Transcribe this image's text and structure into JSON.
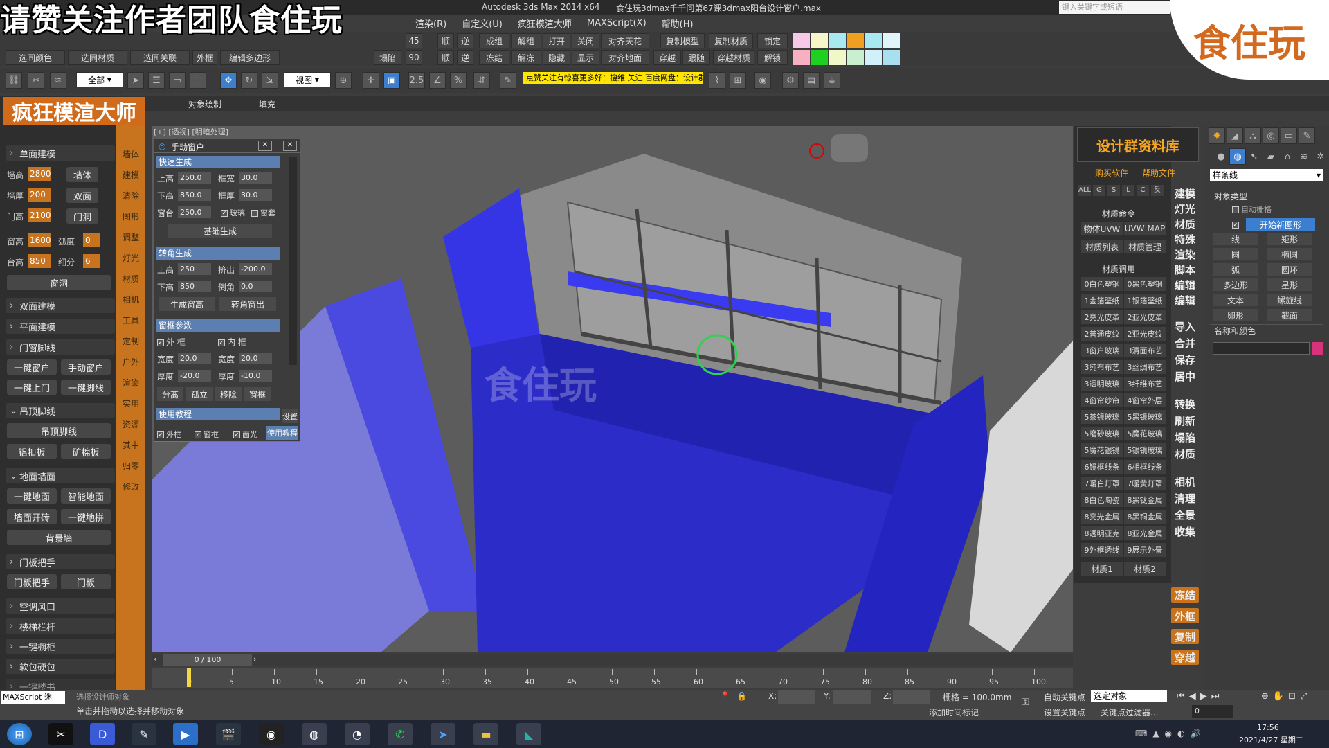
{
  "overlay_title": "请赞关注作者团队食住玩",
  "window": {
    "app_title": "Autodesk 3ds Max  2014 x64",
    "file_title": "食住玩3dmax千千问第67课3dmax阳台设计窗户.max",
    "search_placeholder": "键入关键字或短语"
  },
  "corner_logo": "食住玩",
  "menu": [
    "渲染(R)",
    "自定义(U)",
    "疯狂模渲大师",
    "MAXScript(X)",
    "帮助(H)"
  ],
  "toolbar_row1": [
    "成组",
    "解组",
    "打开",
    "关闭",
    "对齐天花",
    "复制模型",
    "复制材质",
    "锁定"
  ],
  "toolbar_row2": [
    "选同颜色",
    "选同材质",
    "选同关联",
    "外框",
    "编辑多边形",
    "塌陷",
    "冻结",
    "解冻",
    "隐藏",
    "显示",
    "对齐地面",
    "穿越",
    "跟随",
    "穿越材质",
    "解锁"
  ],
  "toolbar_small": [
    "45",
    "90",
    "顺",
    "逆",
    "顺",
    "逆"
  ],
  "swatch_colors": [
    "#f6c9e6",
    "#f6f6c8",
    "#a8e8f0",
    "#f0a020",
    "#a8e8f0",
    "#e0f4fa",
    "#f6b0c0",
    "#20d020",
    "#f0f8c8",
    "#c8f0d0",
    "#d0f0fa",
    "#a8e0f0"
  ],
  "toolbar2": {
    "select_filter": "全部",
    "view_dropdown": "视图",
    "yellow_note": "点赞关注有惊喜更多好：搜维·关注 百度网盘：设计群资料库"
  },
  "ribbon": [
    "对象绘制",
    "填充"
  ],
  "brand": "疯狂模渲大师",
  "sidebar": {
    "sections": [
      "单面建模",
      "双面建模",
      "平面建模",
      "门窗脚线",
      "吊顶脚线",
      "地面墙面",
      "门板把手",
      "空调风口",
      "楼梯栏杆",
      "一键橱柜",
      "软包硬包",
      "一键楼书"
    ],
    "fields": [
      {
        "label": "墙高",
        "value": "2800",
        "button": "墙体"
      },
      {
        "label": "墙厚",
        "value": "200",
        "button": "双面"
      },
      {
        "label": "门高",
        "value": "2100",
        "button": "门洞"
      }
    ],
    "window_fields": [
      {
        "label": "窗高",
        "value": "1600",
        "label2": "弧度",
        "value2": "0"
      },
      {
        "label": "台高",
        "value": "850",
        "label2": "细分",
        "value2": "6"
      }
    ],
    "buttons": {
      "window_hole": "窗洞",
      "one_key_window": "一键窗户",
      "manual_window": "手动窗户",
      "one_key_door": "一键上门",
      "one_key_baseboard": "一键脚线",
      "ceiling_baseboard": "吊顶脚线",
      "aluminum": "铝扣板",
      "mineral": "矿棉板",
      "one_key_floor": "一键地面",
      "smart_floor": "智能地面",
      "wall_tile": "墙面开砖",
      "one_key_tile": "一键地拼",
      "background_wall": "背景墙",
      "door_handle": "门板把手",
      "door_panel": "门板"
    },
    "orange_col": [
      "墙体",
      "建模",
      "清除",
      "图形",
      "调整",
      "灯光",
      "材质",
      "相机",
      "工具",
      "定制",
      "户外",
      "渲染",
      "实用",
      "资源",
      "其中",
      "归零",
      "修改"
    ]
  },
  "viewport": {
    "label": "[+] [透视] [明暗处理]",
    "watermark": "食住玩"
  },
  "dialog": {
    "title": "手动窗户",
    "sec1": "快速生成",
    "row1": {
      "l1": "上高",
      "v1": "250.0",
      "l2": "框宽",
      "v2": "30.0"
    },
    "row2": {
      "l1": "下高",
      "v1": "850.0",
      "l2": "框厚",
      "v2": "30.0"
    },
    "row3": {
      "l1": "窗台",
      "v1": "250.0",
      "c1": "玻璃",
      "c2": "窗套"
    },
    "basic_gen": "基础生成",
    "sec2": "转角生成",
    "row4": {
      "l1": "上高",
      "v1": "250",
      "l2": "挤出",
      "v2": "-200.0"
    },
    "row5": {
      "l1": "下高",
      "v1": "850",
      "l2": "倒角",
      "v2": "0.0"
    },
    "gen_sill": "生成窗高",
    "corner_out": "转角窗出",
    "sec3": "窗框参数",
    "outer": "外 框",
    "inner": "内 框",
    "row6": {
      "l1": "宽度",
      "v1": "20.0",
      "l2": "宽度",
      "v2": "20.0"
    },
    "row7": {
      "l1": "厚度",
      "v1": "-20.0",
      "l2": "厚度",
      "v2": "-10.0"
    },
    "btns": [
      "分离",
      "孤立",
      "移除",
      "窗框"
    ],
    "sec4": "使用教程",
    "footer": [
      "外框",
      "窗框",
      "面光"
    ],
    "tutorial": "使用教程",
    "side_btn": "设置"
  },
  "matpanel": {
    "banner": "设计群资料库",
    "links": [
      "购买软件",
      "帮助文件"
    ],
    "filters": [
      "ALL",
      "G",
      "S",
      "L",
      "C",
      "反"
    ],
    "cmd_title": "材质命令",
    "cmds": [
      "物体UVW",
      "UVW MAP",
      "材质列表",
      "材质管理"
    ],
    "use_title": "材质调用",
    "mats": [
      "0白色塑钢",
      "0黑色塑钢",
      "1金箔壁纸",
      "1银箔壁纸",
      "2亮光皮革",
      "2亚光皮革",
      "2普通皮纹",
      "2亚光皮纹",
      "3窗户玻璃",
      "3清面布艺",
      "3纯布布艺",
      "3丝绸布艺",
      "3透明玻璃",
      "3纤维布艺",
      "4窗帘纱帘",
      "4窗帘外层",
      "5茶镜玻璃",
      "5黑镜玻璃",
      "5磨砂玻璃",
      "5魔花玻璃",
      "5魔花银镜",
      "5银镜玻璃",
      "6镜框线条",
      "6相框线条",
      "7暖白灯罩",
      "7暖黄灯罩",
      "8白色陶瓷",
      "8黑钛金属",
      "8亮光金属",
      "8黑铜金属",
      "8透明亚克",
      "8亚光金属",
      "9外框透线",
      "9展示外景"
    ],
    "bottom": [
      "材质1",
      "材质2"
    ]
  },
  "vcol": [
    "建模",
    "灯光",
    "材质",
    "特殊",
    "渲染",
    "脚本",
    "编辑",
    "编辑",
    "导入",
    "合并",
    "保存",
    "居中",
    "转换",
    "刷新",
    "塌陷",
    "材质",
    "相机",
    "清理",
    "全景",
    "收集",
    "冻结",
    "外框",
    "复制",
    "穿越"
  ],
  "cmdpanel": {
    "dropdown": "样条线",
    "obj_type": "对象类型",
    "autogrid": "自动栅格",
    "start_new": "开始新图形",
    "shapes": [
      "线",
      "矩形",
      "圆",
      "椭圆",
      "弧",
      "圆环",
      "多边形",
      "星形",
      "文本",
      "螺旋线",
      "卵形",
      "截面"
    ],
    "name_color": "名称和颜色"
  },
  "timeline": {
    "frame": "0 / 100",
    "ticks": [
      "0",
      "5",
      "10",
      "15",
      "20",
      "25",
      "30",
      "35",
      "40",
      "45",
      "50",
      "55",
      "60",
      "65",
      "70",
      "75",
      "80",
      "85",
      "90",
      "95",
      "100"
    ]
  },
  "status": {
    "maxscript": "MAXScript 迷",
    "hint": "单击并拖动以选择并移动对象",
    "hint2": "选择设计师对象",
    "grid": "栅格 = 100.0mm",
    "x": "X:",
    "y": "Y:",
    "z": "Z:",
    "auto_key": "自动关键点",
    "set_key": "设置关键点",
    "selection": "选定对象",
    "key_filter": "关键点过滤器...",
    "add_time_tag": "添加时间标记",
    "frame_value": "0"
  },
  "taskbar": {
    "time": "17:56",
    "date": "2021/4/27 星期二"
  }
}
